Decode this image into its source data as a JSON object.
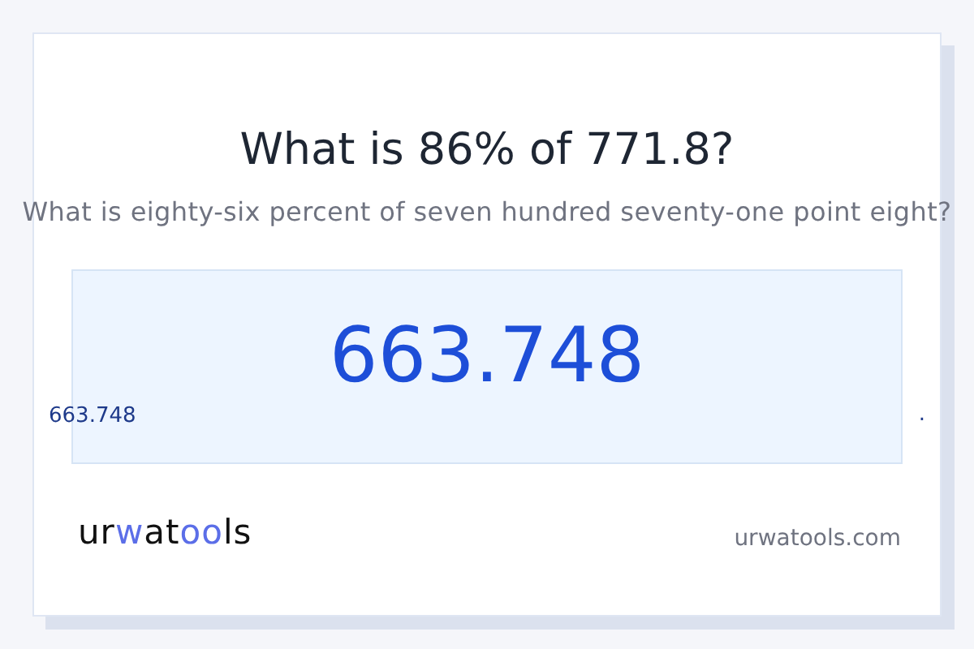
{
  "title": "What is 86% of 771.8?",
  "subtitle": "What is eighty-six percent of seven hundred seventy-one point eight?",
  "result": {
    "value": "663.748",
    "caption": "663.748",
    "mark": "."
  },
  "logo": [
    {
      "text": "ur",
      "accent": false
    },
    {
      "text": "w",
      "accent": true
    },
    {
      "text": "at",
      "accent": false
    },
    {
      "text": "oo",
      "accent": true
    },
    {
      "text": "ls",
      "accent": false
    }
  ],
  "site": "urwatools.com"
}
